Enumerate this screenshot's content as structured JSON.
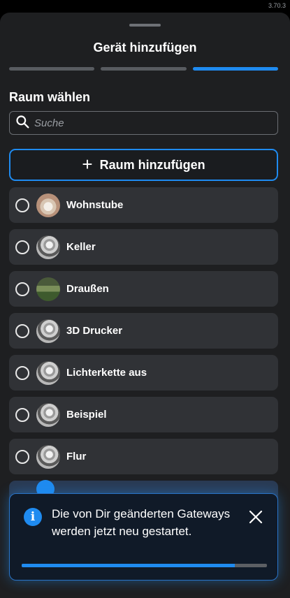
{
  "version": "3.70.3",
  "header": {
    "title": "Gerät hinzufügen"
  },
  "progress_steps": [
    {
      "active": false
    },
    {
      "active": false
    },
    {
      "active": true
    }
  ],
  "room_section": {
    "title": "Raum wählen",
    "search": {
      "placeholder": "Suche",
      "value": ""
    },
    "add_room_label": "Raum hinzufügen",
    "rooms": [
      {
        "label": "Wohnstube",
        "thumb": "living",
        "selected": false
      },
      {
        "label": "Keller",
        "thumb": "house",
        "selected": false
      },
      {
        "label": "Draußen",
        "thumb": "garden",
        "selected": false
      },
      {
        "label": "3D Drucker",
        "thumb": "house",
        "selected": false
      },
      {
        "label": "Lichterkette aus",
        "thumb": "house",
        "selected": false
      },
      {
        "label": "Beispiel",
        "thumb": "house",
        "selected": false
      },
      {
        "label": "Flur",
        "thumb": "house",
        "selected": false
      }
    ]
  },
  "toast": {
    "message": "Die von Dir geänderten Gateways werden jetzt neu gestartet.",
    "progress": 0.87
  },
  "colors": {
    "accent": "#1f8bf0",
    "sheet": "#1e1f21",
    "row": "#303236"
  },
  "icons": {
    "search": "search-icon",
    "plus": "plus-icon",
    "info": "info-icon",
    "close": "close-icon"
  }
}
